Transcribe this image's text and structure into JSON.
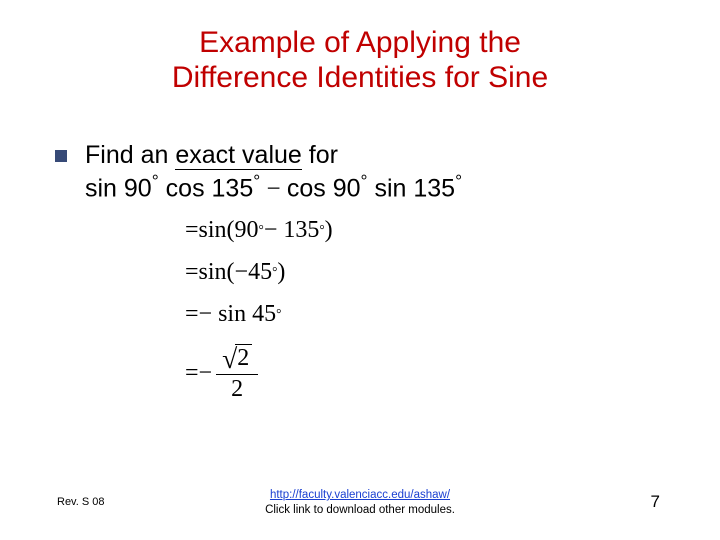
{
  "title_line1": "Example of Applying the",
  "title_line2": "Difference Identities for Sine",
  "bullet": {
    "lead": "Find an ",
    "exact_value": "exact value",
    "tail": " for",
    "expr_prefix": "sin 90",
    "deg": "°",
    "cos135": " cos 135",
    "minus": " − ",
    "cos90": "cos 90",
    "sin135": " sin 135"
  },
  "math": {
    "eq": "=",
    "step1_a": " sin(90",
    "step1_b": " − 135",
    "step1_c": ")",
    "step2_a": " sin(−45",
    "step2_b": ")",
    "step3_a": " − sin 45",
    "step4_prefix": " − ",
    "sqrt_radicand": "2",
    "den": "2",
    "radical": "√"
  },
  "footer": {
    "rev": "Rev. S 08",
    "link": "http://faculty.valenciacc.edu/ashaw/",
    "link_caption": "Click link to download other modules.",
    "page": "7"
  }
}
